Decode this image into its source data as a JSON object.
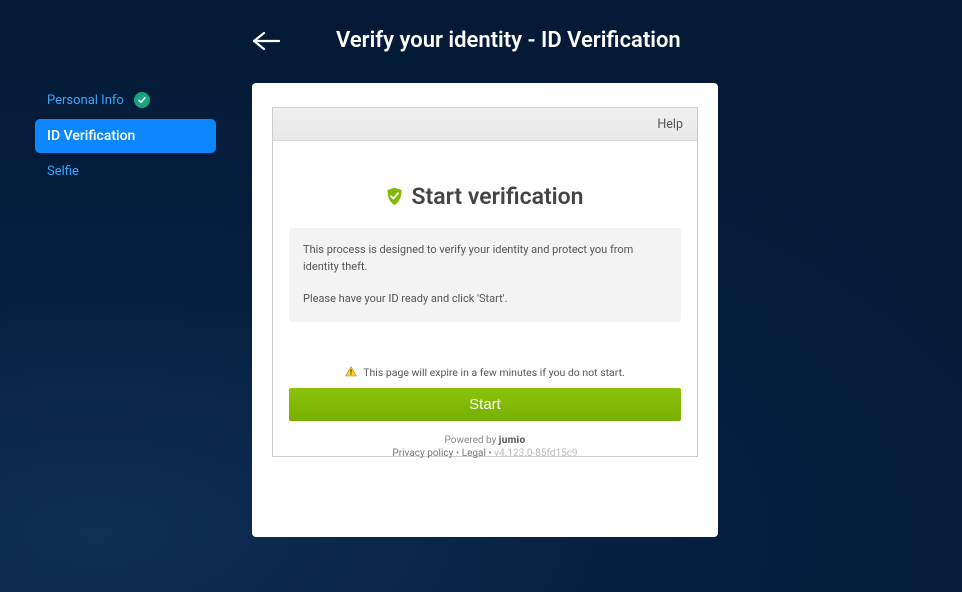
{
  "header": {
    "title": "Verify your identity - ID Verification"
  },
  "sidebar": {
    "items": [
      {
        "label": "Personal Info",
        "state": "done"
      },
      {
        "label": "ID Verification",
        "state": "active"
      },
      {
        "label": "Selfie",
        "state": "pending"
      }
    ]
  },
  "frame": {
    "help": "Help",
    "heading": "Start verification",
    "info_line1": "This process is designed to verify your identity and protect you from identity theft.",
    "info_line2": "Please have your ID ready and click 'Start'.",
    "expire_text": "This page will expire in a few minutes if you do not start.",
    "start_button": "Start",
    "powered_by_prefix": "Powered by ",
    "powered_by_brand": "jumio",
    "privacy": "Privacy policy",
    "legal": "Legal",
    "separator": " • ",
    "version": "v4.123.0-85fd15c9"
  }
}
